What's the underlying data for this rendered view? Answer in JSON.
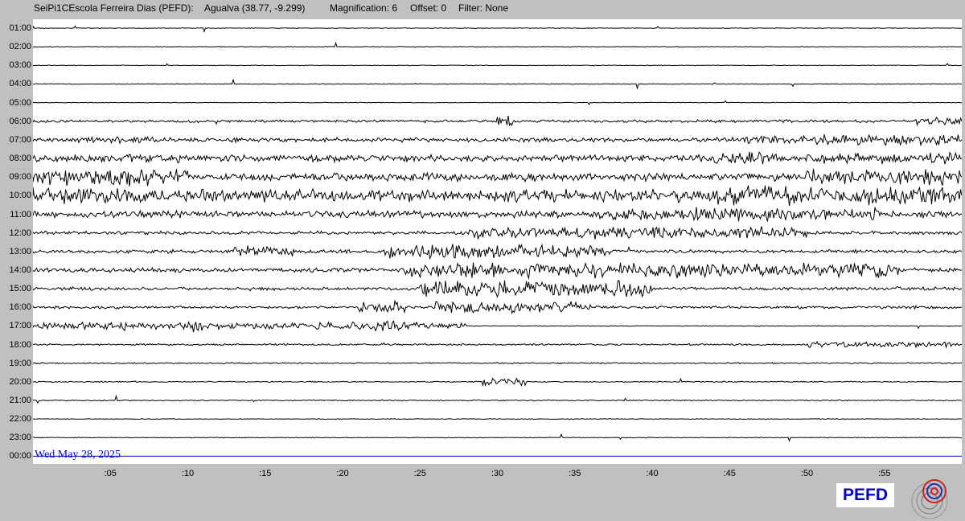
{
  "header": {
    "station": "SeiPi1CEscola Ferreira Dias (PEFD):",
    "location": "Agualva (38.77, -9.299)",
    "magnification": "Magnification: 6",
    "offset": "Offset: 0",
    "filter": "Filter: None"
  },
  "date_label": "Wed May 28, 2025",
  "station_badge": "PEFD",
  "colors": {
    "trace": "#000000",
    "current_line": "#0000cc",
    "date": "#0000cc",
    "background": "#c0c0c0"
  },
  "chart_data": {
    "type": "line",
    "title": "",
    "xlabel": "",
    "ylabel": "",
    "hour_labels": [
      "01:00",
      "02:00",
      "03:00",
      "04:00",
      "05:00",
      "06:00",
      "07:00",
      "08:00",
      "09:00",
      "10:00",
      "11:00",
      "12:00",
      "13:00",
      "14:00",
      "15:00",
      "16:00",
      "17:00",
      "18:00",
      "19:00",
      "20:00",
      "21:00",
      "22:00",
      "23:00",
      "00:00"
    ],
    "minute_ticks": [
      {
        "minute": 5,
        "label": ":05"
      },
      {
        "minute": 10,
        "label": ":10"
      },
      {
        "minute": 15,
        "label": ":15"
      },
      {
        "minute": 20,
        "label": ":20"
      },
      {
        "minute": 25,
        "label": ":25"
      },
      {
        "minute": 30,
        "label": ":30"
      },
      {
        "minute": 35,
        "label": ":35"
      },
      {
        "minute": 40,
        "label": ":40"
      },
      {
        "minute": 45,
        "label": ":45"
      },
      {
        "minute": 50,
        "label": ":50"
      },
      {
        "minute": 55,
        "label": ":55"
      }
    ],
    "x_range": [
      0,
      60
    ],
    "current_hour_index": 23,
    "activity_windows": [
      {
        "hour": "06:00",
        "windows": [
          [
            0,
            60,
            0.12
          ],
          [
            30,
            31,
            0.5
          ],
          [
            57,
            60,
            0.35
          ]
        ]
      },
      {
        "hour": "07:00",
        "windows": [
          [
            0,
            60,
            0.2
          ],
          [
            2,
            8,
            0.3
          ],
          [
            46,
            60,
            0.45
          ]
        ]
      },
      {
        "hour": "08:00",
        "windows": [
          [
            0,
            60,
            0.3
          ],
          [
            0,
            10,
            0.4
          ],
          [
            44,
            48,
            0.55
          ],
          [
            50,
            60,
            0.5
          ]
        ]
      },
      {
        "hour": "09:00",
        "windows": [
          [
            0,
            60,
            0.35
          ],
          [
            0,
            10,
            0.8
          ],
          [
            50,
            60,
            0.7
          ]
        ]
      },
      {
        "hour": "10:00",
        "windows": [
          [
            0,
            60,
            0.55
          ],
          [
            0,
            8,
            0.7
          ],
          [
            44,
            60,
            0.8
          ]
        ]
      },
      {
        "hour": "11:00",
        "windows": [
          [
            0,
            60,
            0.3
          ],
          [
            36,
            55,
            0.55
          ]
        ]
      },
      {
        "hour": "12:00",
        "windows": [
          [
            0,
            60,
            0.15
          ],
          [
            28,
            50,
            0.5
          ]
        ]
      },
      {
        "hour": "13:00",
        "windows": [
          [
            0,
            60,
            0.15
          ],
          [
            13,
            17,
            0.45
          ],
          [
            23,
            37,
            0.6
          ]
        ]
      },
      {
        "hour": "14:00",
        "windows": [
          [
            0,
            60,
            0.2
          ],
          [
            24,
            56,
            0.65
          ]
        ]
      },
      {
        "hour": "15:00",
        "windows": [
          [
            0,
            60,
            0.15
          ],
          [
            25,
            40,
            0.7
          ]
        ]
      },
      {
        "hour": "16:00",
        "windows": [
          [
            0,
            60,
            0.12
          ],
          [
            21,
            24,
            0.6
          ],
          [
            26,
            36,
            0.5
          ]
        ]
      },
      {
        "hour": "17:00",
        "windows": [
          [
            0,
            28,
            0.3
          ],
          [
            10,
            11,
            0.6
          ],
          [
            20,
            24,
            0.45
          ]
        ]
      },
      {
        "hour": "18:00",
        "windows": [
          [
            0,
            60,
            0.08
          ],
          [
            50,
            60,
            0.25
          ]
        ]
      },
      {
        "hour": "19:00",
        "windows": [
          [
            0,
            60,
            0.06
          ]
        ]
      },
      {
        "hour": "20:00",
        "windows": [
          [
            0,
            60,
            0.05
          ],
          [
            29,
            32,
            0.35
          ]
        ]
      },
      {
        "hour": "21:00",
        "windows": [
          [
            0,
            60,
            0.05
          ]
        ]
      }
    ]
  }
}
